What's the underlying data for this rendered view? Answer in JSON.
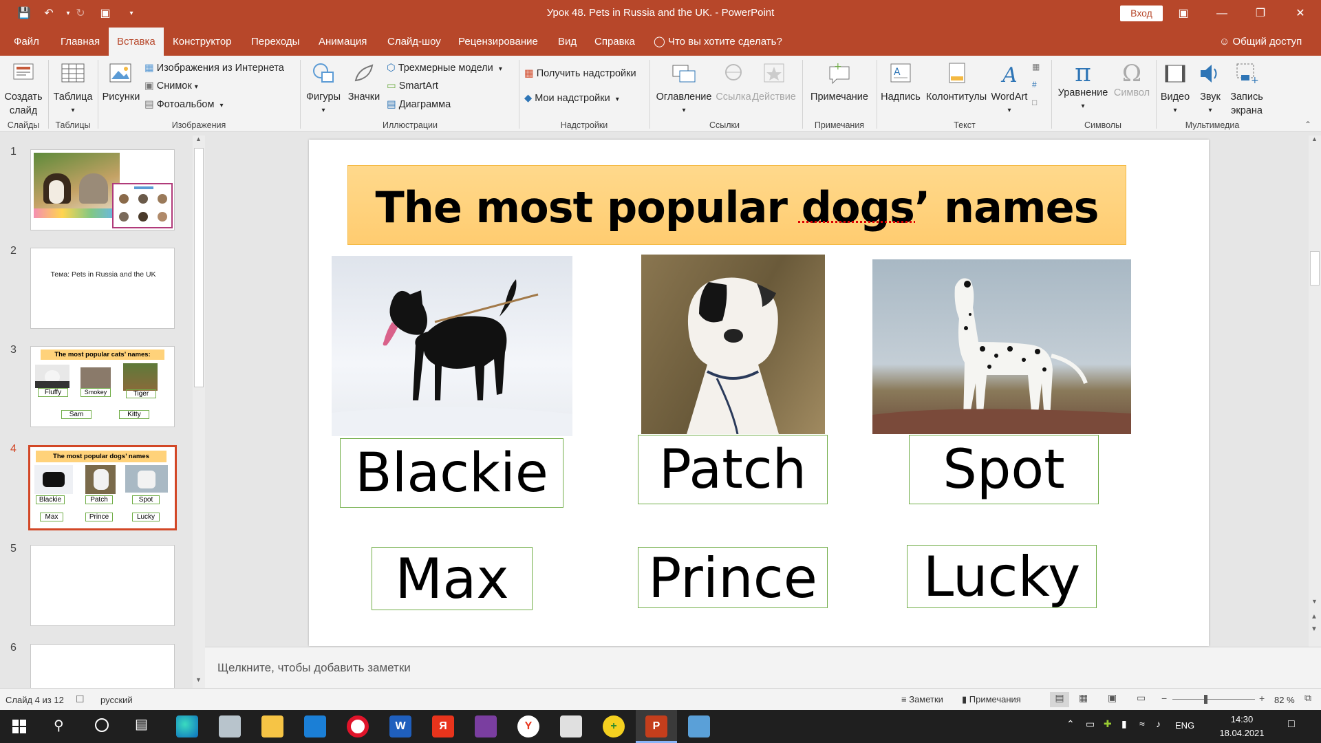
{
  "titlebar": {
    "title": "Урок 48. Pets in Russia and the UK.  -  PowerPoint",
    "signin": "Вход"
  },
  "menu": {
    "tabs": [
      "Файл",
      "Главная",
      "Вставка",
      "Конструктор",
      "Переходы",
      "Анимация",
      "Слайд-шоу",
      "Рецензирование",
      "Вид",
      "Справка"
    ],
    "active_tab": "Вставка",
    "tell_me": "Что вы хотите сделать?",
    "share": "Общий доступ"
  },
  "ribbon": {
    "new_slide": "Создать слайд",
    "table": "Таблица",
    "pictures": "Рисунки",
    "online_pictures": "Изображения из Интернета",
    "screenshot": "Снимок",
    "photo_album": "Фотоальбом",
    "shapes": "Фигуры",
    "icons": "Значки",
    "models_3d": "Трехмерные модели",
    "smartart": "SmartArt",
    "chart": "Диаграмма",
    "get_addins": "Получить надстройки",
    "my_addins": "Мои надстройки",
    "zoom": "Оглавление",
    "link": "Ссылка",
    "action": "Действие",
    "comment": "Примечание",
    "textbox": "Надпись",
    "header_footer": "Колонтитулы",
    "wordart": "WordArt",
    "equation": "Уравнение",
    "symbol": "Символ",
    "video": "Видео",
    "audio": "Звук",
    "screen_recording": "Запись экрана",
    "groups": {
      "slides": "Слайды",
      "tables": "Таблицы",
      "images": "Изображения",
      "illustrations": "Иллюстрации",
      "addins": "Надстройки",
      "links": "Ссылки",
      "comments": "Примечания",
      "text": "Текст",
      "symbols": "Символы",
      "media": "Мультимедиа"
    }
  },
  "thumbnails": {
    "numbers": [
      "1",
      "2",
      "3",
      "4",
      "5",
      "6"
    ],
    "slide2_text": "Тема: Pets in Russia and  the UK",
    "slide3_title": "The most popular cats’ names:",
    "slide3_names": [
      "Fluffy",
      "Smokey",
      "Tiger",
      "Sam",
      "Kitty"
    ],
    "slide4_title": "The most popular dogs’ names",
    "slide4_names": [
      "Blackie",
      "Patch",
      "Spot",
      "Max",
      "Prince",
      "Lucky"
    ],
    "selected": 4
  },
  "slide": {
    "title": "The most popular dogs’ names",
    "names": [
      "Blackie",
      "Patch",
      "Spot",
      "Max",
      "Prince",
      "Lucky"
    ]
  },
  "notes": {
    "placeholder": "Щелкните, чтобы добавить заметки"
  },
  "status": {
    "slide_info": "Слайд 4 из 12",
    "language": "русский",
    "notes": "Заметки",
    "comments": "Примечания",
    "zoom": "82 %"
  },
  "taskbar": {
    "lang": "ENG",
    "time": "14:30",
    "date": "18.04.2021"
  }
}
